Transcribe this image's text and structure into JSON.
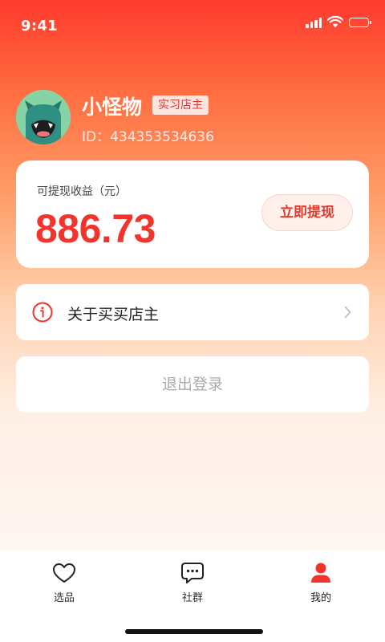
{
  "status_bar": {
    "time": "9:41",
    "icons": [
      "cellular-signal-icon",
      "wifi-icon",
      "battery-icon"
    ]
  },
  "profile": {
    "name": "小怪物",
    "badge": "实习店主",
    "id_text": "ID：434353534636",
    "avatar_icon": "green-monster-avatar"
  },
  "earnings": {
    "label": "可提现收益（元）",
    "amount": "886.73",
    "withdraw_label": "立即提现"
  },
  "menu": {
    "about_label": "关于买买店主",
    "about_icon": "info-icon"
  },
  "logout_label": "退出登录",
  "tab_bar": {
    "tabs": [
      {
        "label": "选品",
        "icon": "heart-icon",
        "active": false
      },
      {
        "label": "社群",
        "icon": "chat-bubble-icon",
        "active": false
      },
      {
        "label": "我的",
        "icon": "user-icon",
        "active": true
      }
    ]
  },
  "colors": {
    "accent": "#f2342d",
    "header_gradient_top": "#ff3a2e",
    "page_background": "#fff6f1"
  }
}
